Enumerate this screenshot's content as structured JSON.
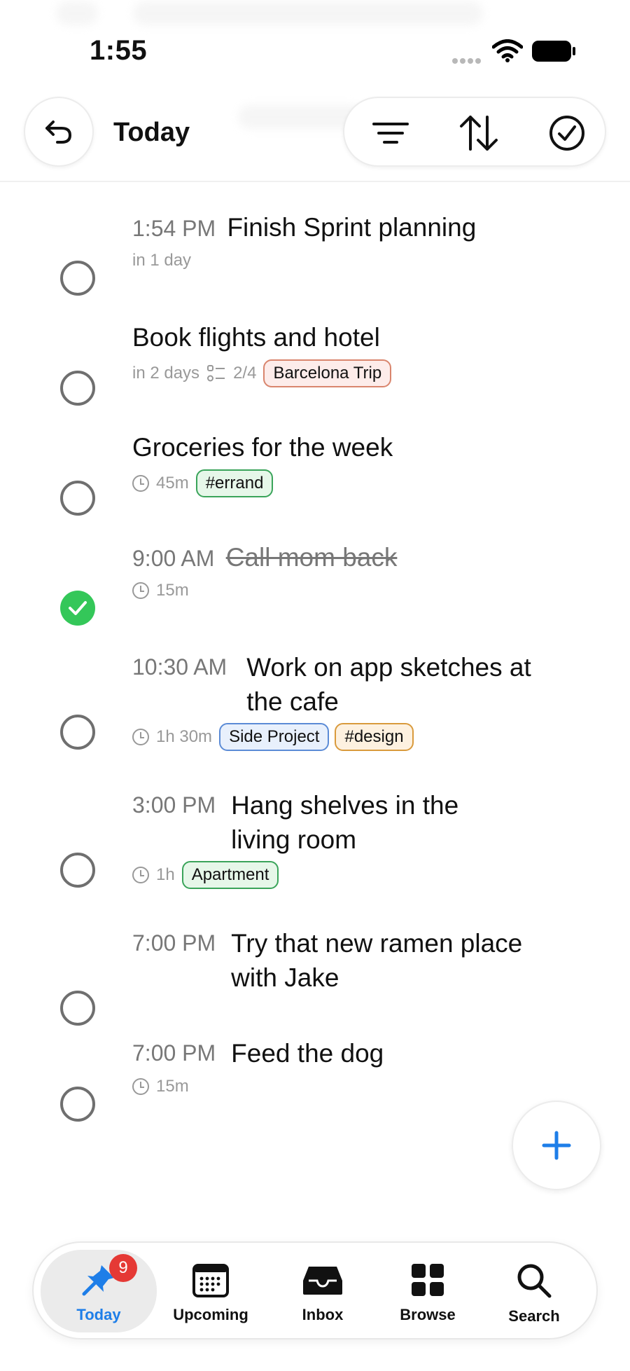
{
  "status_bar": {
    "time": "1:55"
  },
  "header": {
    "title": "Today"
  },
  "colors": {
    "accent": "#1e7ee8",
    "done": "#34c759",
    "badge": "#e53935"
  },
  "tasks": [
    {
      "time": "1:54 PM",
      "title": "Finish Sprint planning",
      "meta": "in 1 day",
      "done": false
    },
    {
      "time": "",
      "title": "Book flights and hotel",
      "meta": "in 2 days",
      "subtasks": "2/4",
      "tags": [
        "Barcelona Trip"
      ],
      "done": false
    },
    {
      "time": "",
      "title": "Groceries for the week",
      "duration": "45m",
      "tags": [
        "#errand"
      ],
      "done": false
    },
    {
      "time": "9:00 AM",
      "title": "Call mom back",
      "duration": "15m",
      "done": true
    },
    {
      "time": "10:30 AM",
      "title": "Work on app sketches at the cafe",
      "duration": "1h 30m",
      "tags": [
        "Side Project",
        "#design"
      ],
      "done": false
    },
    {
      "time": "3:00 PM",
      "title": "Hang shelves in the living room",
      "duration": "1h",
      "tags": [
        "Apartment"
      ],
      "done": false
    },
    {
      "time": "7:00 PM",
      "title": "Try that new ramen place with Jake",
      "done": false
    },
    {
      "time": "7:00 PM",
      "title": "Feed the dog",
      "duration": "15m",
      "done": false
    }
  ],
  "tag_colors": {
    "Barcelona Trip": {
      "bg": "#fdecea",
      "border": "#d9856d"
    },
    "#errand": {
      "bg": "#e6f7e9",
      "border": "#3aa45a"
    },
    "Side Project": {
      "bg": "#e8f0fc",
      "border": "#5b8bd6"
    },
    "#design": {
      "bg": "#fdf1e0",
      "border": "#d99a3c"
    },
    "Apartment": {
      "bg": "#e6f7e9",
      "border": "#3aa45a"
    }
  },
  "tabbar": {
    "items": [
      {
        "label": "Today",
        "icon": "pin-icon",
        "badge": "9"
      },
      {
        "label": "Upcoming",
        "icon": "calendar-icon"
      },
      {
        "label": "Inbox",
        "icon": "inbox-icon"
      },
      {
        "label": "Browse",
        "icon": "grid-icon"
      },
      {
        "label": "Search",
        "icon": "search-icon"
      }
    ]
  }
}
